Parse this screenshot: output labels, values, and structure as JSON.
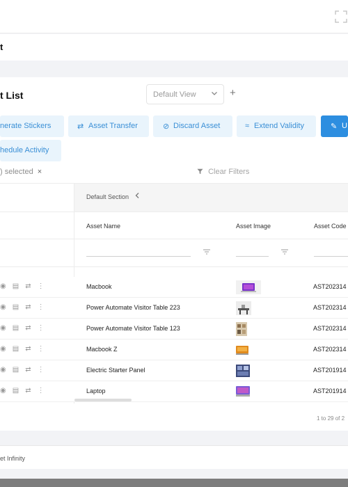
{
  "header": {
    "expand_icon": "fullscreen-icon"
  },
  "subheader": {
    "title": "t"
  },
  "page": {
    "title": "t List",
    "view_select": "Default View",
    "add_view_symbol": "+"
  },
  "actions": [
    {
      "icon": "",
      "label": "nerate Stickers"
    },
    {
      "icon": "⇄",
      "label": "Asset Transfer"
    },
    {
      "icon": "⊘",
      "label": "Discard Asset"
    },
    {
      "icon": "≈",
      "label": "Extend Validity"
    },
    {
      "icon": "✎",
      "label": "U"
    },
    {
      "icon": "",
      "label": "hedule Activity"
    }
  ],
  "selection": {
    "text": ") selected",
    "clear_symbol": "×"
  },
  "filters": {
    "clear_label": "Clear Filters"
  },
  "table": {
    "section_label": "Default Section",
    "columns": [
      "Asset Name",
      "Asset Image",
      "Asset Code"
    ],
    "rows": [
      {
        "name": "Macbook",
        "code": "AST202314"
      },
      {
        "name": "Power Automate Visitor Table 223",
        "code": "AST202314"
      },
      {
        "name": "Power Automate Visitor Table 123",
        "code": "AST202314"
      },
      {
        "name": "Macbook Z",
        "code": "AST202314"
      },
      {
        "name": "Electric Starter Panel",
        "code": "AST201914"
      },
      {
        "name": "Laptop",
        "code": "AST201914"
      }
    ]
  },
  "pagination": {
    "text": "1 to 29 of 2"
  },
  "footer": {
    "text": "et Infinity"
  },
  "colors": {
    "accent": "#2d8ee0",
    "accent_light": "#e9f4fc"
  }
}
